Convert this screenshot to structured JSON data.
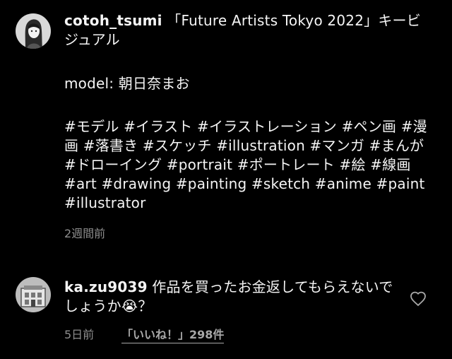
{
  "post": {
    "username": "cotoh_tsumi",
    "caption": " 「Future Artists Tokyo 2022」キービジュアル",
    "model_line": "model: 朝日奈まお",
    "hashtags": [
      "#モデル",
      "#イラスト",
      "#イラストレーション",
      "#ペン画",
      "#漫画",
      "#落書き",
      "#スケッチ",
      "#illustration",
      "#マンガ",
      "#まんが",
      "#ドローイング",
      "#portrait",
      "#ポートレート",
      "#絵",
      "#線画",
      "#art",
      "#drawing",
      "#painting",
      "#sketch",
      "#anime",
      "#paint",
      "#illustrator"
    ],
    "time": "2週間前"
  },
  "comment": {
    "username": "ka.zu9039",
    "text": " 作品を買ったお金返してもらえないでしょうか😭？",
    "time": "5日前",
    "likes_label": "「いいね！」298件"
  },
  "icons": {
    "post_avatar": "portrait-avatar",
    "comment_avatar": "building-avatar",
    "like": "heart-icon"
  }
}
